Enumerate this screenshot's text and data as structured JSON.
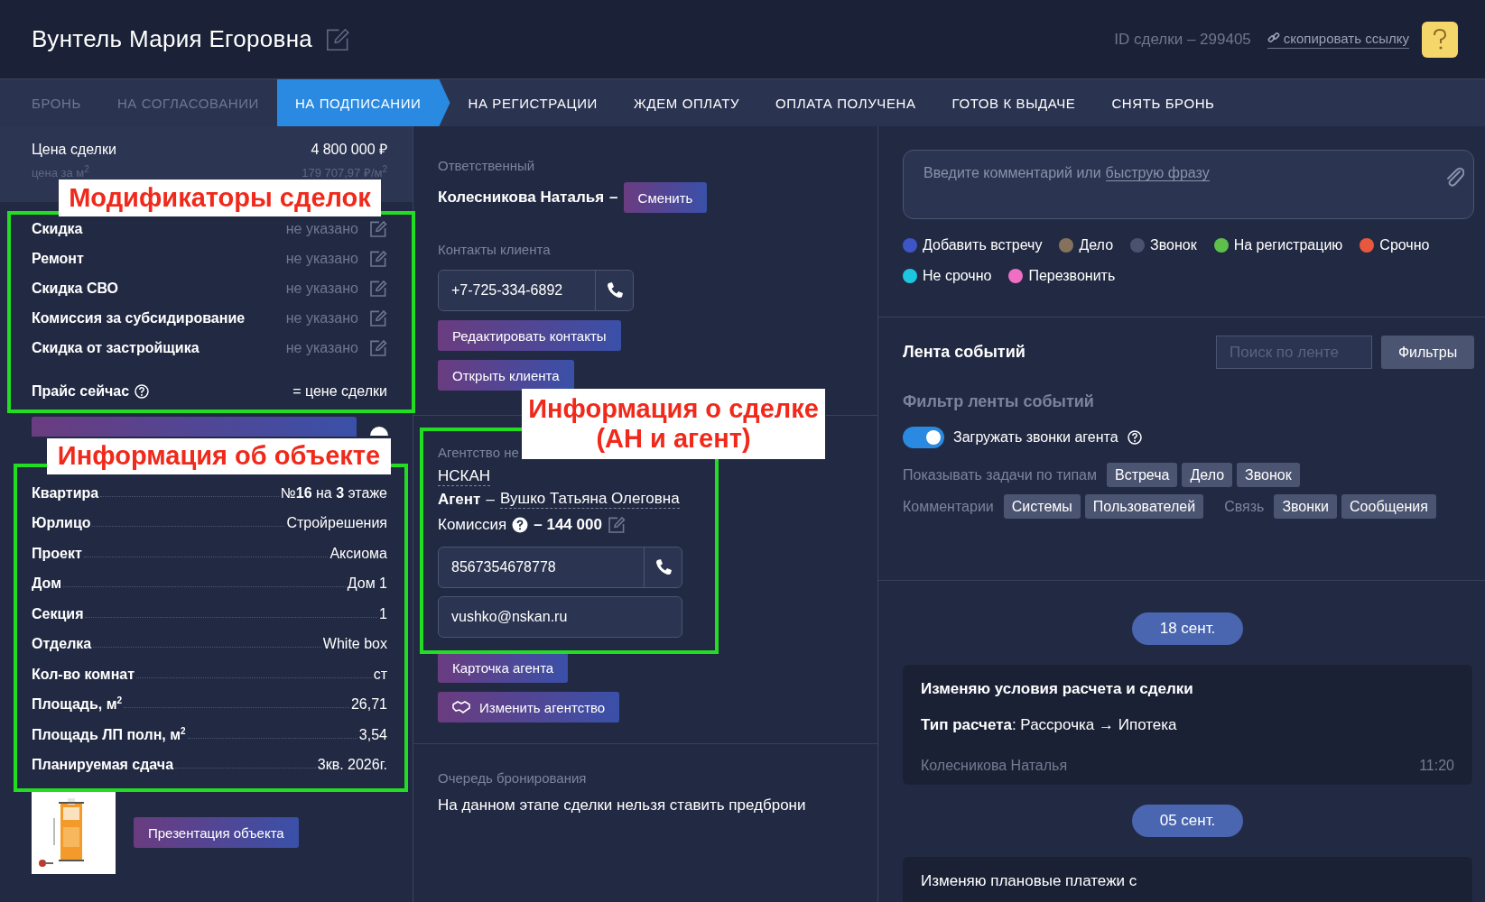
{
  "header": {
    "title": "Вунтель Мария Егоровна",
    "deal_id": "ID сделки – 299405",
    "copy_link": "скопировать ссылку"
  },
  "stages": [
    {
      "label": "БРОНЬ",
      "selected": false,
      "disabled": true
    },
    {
      "label": "НА СОГЛАСОВАНИИ",
      "selected": false,
      "disabled": true
    },
    {
      "label": "НА ПОДПИСАНИИ",
      "selected": true,
      "disabled": false
    },
    {
      "label": "НА РЕГИСТРАЦИИ",
      "selected": false,
      "disabled": false
    },
    {
      "label": "ЖДЕМ ОПЛАТУ",
      "selected": false,
      "disabled": false
    },
    {
      "label": "ОПЛАТА ПОЛУЧЕНА",
      "selected": false,
      "disabled": false
    },
    {
      "label": "ГОТОВ К ВЫДАЧЕ",
      "selected": false,
      "disabled": false
    },
    {
      "label": "СНЯТЬ БРОНЬ",
      "selected": false,
      "disabled": false
    }
  ],
  "price": {
    "label": "Цена сделки",
    "value": "4 800 000 ₽",
    "per_m2_label": "цена за м$^{2}$",
    "per_m2_value": "179 707,97 ₽/м$^{2}$"
  },
  "modifiers": [
    {
      "label": "Скидка",
      "value": "не указано"
    },
    {
      "label": "Ремонт",
      "value": "не указано"
    },
    {
      "label": "Скидка СВО",
      "value": "не указано"
    },
    {
      "label": "Комиссия за субсидирование",
      "value": "не указано"
    },
    {
      "label": "Скидка от застройщика",
      "value": "не указано"
    }
  ],
  "price_now": {
    "label": "Прайс сейчас",
    "value": "= цене сделки"
  },
  "object": [
    {
      "label": "Квартира",
      "value": "№**16** на **3** этаже"
    },
    {
      "label": "Юрлицо",
      "value": "Стройрешения"
    },
    {
      "label": "Проект",
      "value": "Аксиома"
    },
    {
      "label": "Дом",
      "value": "Дом 1"
    },
    {
      "label": "Секция",
      "value": "1"
    },
    {
      "label": "Отделка",
      "value": "White box"
    },
    {
      "label": "Кол-во комнат",
      "value": "ст"
    },
    {
      "label": "Площадь, м$^{2}$",
      "value": "26,71"
    },
    {
      "label": "Площадь ЛП полн, м$^{2}$",
      "value": "3,54"
    },
    {
      "label": "Планируемая сдача",
      "value": "3кв. 2026г."
    }
  ],
  "presentation_button": "Презентация объекта",
  "responsible": {
    "heading": "Ответственный",
    "name": "Колесникова Наталья",
    "dash": "–",
    "button": "Сменить"
  },
  "client_contacts": {
    "heading": "Контакты клиента",
    "phone": "+7-725-334-6892",
    "buttons": [
      "Редактировать контакты",
      "Открыть клиента"
    ]
  },
  "agency": {
    "heading": "Агентство не",
    "name": "НСКАН",
    "agent_label": "Агент",
    "agent_dash": "–",
    "agent_name": "Вушко Татьяна Олеговна",
    "commission_label": "Комиссия",
    "commission_value": "– 144 000",
    "phone": "8567354678778",
    "email": "vushko@nskan.ru",
    "card_button": "Карточка агента",
    "change_button": "Изменить агентство"
  },
  "booking_queue": {
    "heading": "Очередь бронирования",
    "text": "На данном этапе сделки нельзя ставить предброни"
  },
  "comment": {
    "placeholder": "Введите комментарий или",
    "link": "быструю фразу"
  },
  "quick_tags": [
    {
      "label": "Добавить встречу",
      "color": "#3d55c6"
    },
    {
      "label": "Дело",
      "color": "#85725d"
    },
    {
      "label": "Звонок",
      "color": "#4a5270"
    },
    {
      "label": "На регистрацию",
      "color": "#5dc04a"
    },
    {
      "label": "Срочно",
      "color": "#e8583e"
    },
    {
      "label": "Не срочно",
      "color": "#1dc6df"
    },
    {
      "label": "Перезвонить",
      "color": "#ef6fc5"
    }
  ],
  "feed": {
    "title": "Лента событий",
    "search": {
      "placeholder": "Поиск по ленте"
    },
    "filters_button": "Фильтры",
    "filter_title": "Фильтр ленты событий",
    "toggle": {
      "label": "Загружать звонки агента",
      "on": true
    },
    "task_types_label": "Показывать задачи по типам",
    "task_types": [
      "Встреча",
      "Дело",
      "Звонок"
    ],
    "comments_label": "Комментарии",
    "comment_types": [
      "Системы",
      "Пользователей"
    ],
    "link_label": "Связь",
    "link_types": [
      "Звонки",
      "Сообщения"
    ]
  },
  "events": [
    {
      "date": "18 сент.",
      "title": "Изменяю условия расчета и сделки",
      "emphasis": true,
      "detail": "**Тип расчета**: Рассрочка → Ипотека",
      "author": "Колесникова Наталья",
      "time": "11:20"
    },
    {
      "date": "05 сент.",
      "title": "Изменяю плановые платежи с",
      "emphasis": false
    }
  ],
  "annotations": [
    {
      "kind": "frame"
    },
    {
      "kind": "label",
      "text": "Модификаторы сделок"
    },
    {
      "kind": "frame"
    },
    {
      "kind": "label",
      "text": "Информация об объекте"
    },
    {
      "kind": "frame"
    },
    {
      "kind": "label",
      "text": "Информация о сделке\n(АН и агент)"
    }
  ]
}
